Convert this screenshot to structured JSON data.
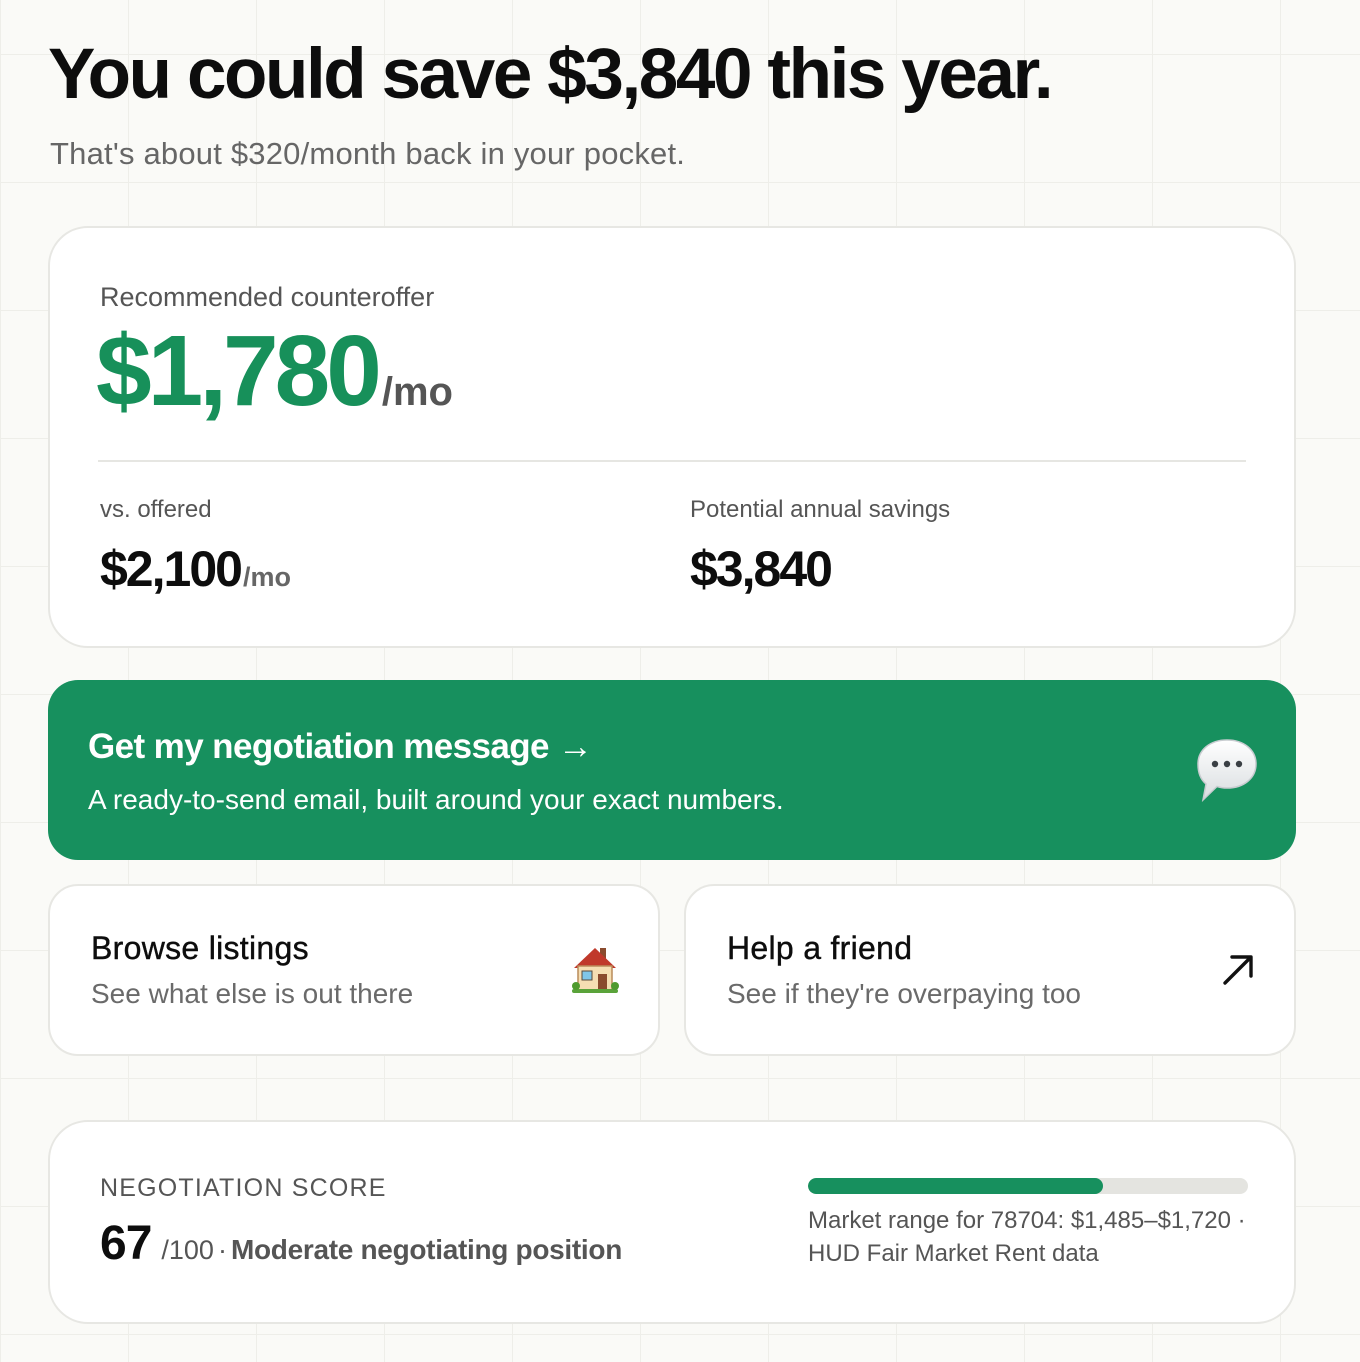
{
  "header": {
    "headline": "You could save $3,840 this year.",
    "subline": "That's about $320/month back in your pocket."
  },
  "counteroffer": {
    "label": "Recommended counteroffer",
    "value": "$1,780",
    "unit": "/mo",
    "offered_label": "vs. offered",
    "offered_value": "$2,100",
    "offered_unit": "/mo",
    "savings_label": "Potential annual savings",
    "savings_value": "$3,840"
  },
  "cta": {
    "title": "Get my negotiation message →",
    "subtitle": "A ready-to-send email, built around your exact numbers.",
    "icon": "speech-bubble-icon"
  },
  "tiles": {
    "browse": {
      "title": "Browse listings",
      "subtitle": "See what else is out there",
      "icon": "house-icon"
    },
    "help": {
      "title": "Help a friend",
      "subtitle": "See if they're overpaying too",
      "icon": "arrow-up-right-icon"
    }
  },
  "score": {
    "label": "NEGOTIATION SCORE",
    "value": "67",
    "max": "/100",
    "separator": "·",
    "description": "Moderate negotiating position",
    "progress": 0.67,
    "market_range": "Market range for 78704: $1,485–$1,720 · HUD Fair Market Rent data"
  },
  "colors": {
    "accent_green": "#17905e",
    "background": "#fafaf7",
    "card": "#ffffff"
  }
}
